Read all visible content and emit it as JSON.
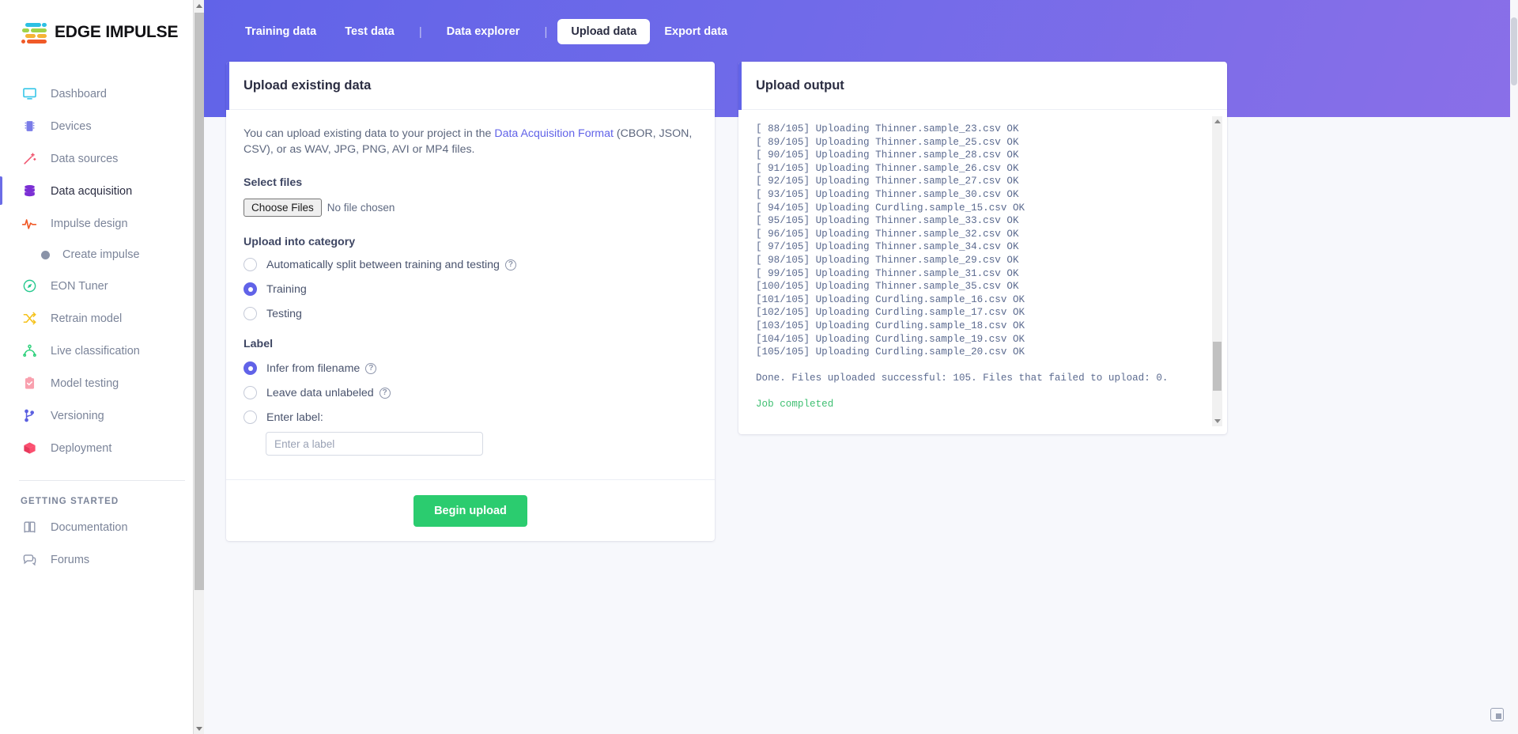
{
  "brand": {
    "name": "EDGE IMPULSE"
  },
  "sidebar": {
    "items": [
      {
        "label": "Dashboard",
        "icon": "monitor-icon"
      },
      {
        "label": "Devices",
        "icon": "chip-icon"
      },
      {
        "label": "Data sources",
        "icon": "wand-icon"
      },
      {
        "label": "Data acquisition",
        "icon": "database-icon"
      },
      {
        "label": "Impulse design",
        "icon": "pulse-icon"
      }
    ],
    "sub_item": {
      "label": "Create impulse",
      "icon": "dot-icon"
    },
    "items2": [
      {
        "label": "EON Tuner",
        "icon": "compass-icon"
      },
      {
        "label": "Retrain model",
        "icon": "shuffle-icon"
      },
      {
        "label": "Live classification",
        "icon": "network-icon"
      },
      {
        "label": "Model testing",
        "icon": "clipboard-check-icon"
      },
      {
        "label": "Versioning",
        "icon": "branch-icon"
      },
      {
        "label": "Deployment",
        "icon": "cube-icon"
      }
    ],
    "section_label": "GETTING STARTED",
    "items3": [
      {
        "label": "Documentation",
        "icon": "book-icon"
      },
      {
        "label": "Forums",
        "icon": "chat-icon"
      }
    ]
  },
  "tabs": [
    {
      "label": "Training data",
      "active": false
    },
    {
      "label": "Test data",
      "active": false
    },
    {
      "label": "Data explorer",
      "active": false
    },
    {
      "label": "Upload data",
      "active": true
    },
    {
      "label": "Export data",
      "active": false
    }
  ],
  "upload_card": {
    "title": "Upload existing data",
    "intro_1": "You can upload existing data to your project in the ",
    "intro_link": "Data Acquisition Format",
    "intro_2": " (CBOR, JSON, CSV), or as WAV, JPG, PNG, AVI or MP4 files.",
    "select_files_label": "Select files",
    "choose_files_button": "Choose Files",
    "no_file_chosen": "No file chosen",
    "category_label": "Upload into category",
    "category_options": [
      {
        "label": "Automatically split between training and testing",
        "checked": false,
        "help": true
      },
      {
        "label": "Training",
        "checked": true,
        "help": false
      },
      {
        "label": "Testing",
        "checked": false,
        "help": false
      }
    ],
    "label_group_label": "Label",
    "label_options": [
      {
        "label": "Infer from filename",
        "checked": true,
        "help": true
      },
      {
        "label": "Leave data unlabeled",
        "checked": false,
        "help": true
      },
      {
        "label": "Enter label:",
        "checked": false,
        "help": false
      }
    ],
    "label_input_value": "",
    "label_input_placeholder": "Enter a label",
    "begin_upload_button": "Begin upload"
  },
  "output_card": {
    "title": "Upload output",
    "lines": [
      "[ 88/105] Uploading Thinner.sample_23.csv OK",
      "[ 89/105] Uploading Thinner.sample_25.csv OK",
      "[ 90/105] Uploading Thinner.sample_28.csv OK",
      "[ 91/105] Uploading Thinner.sample_26.csv OK",
      "[ 92/105] Uploading Thinner.sample_27.csv OK",
      "[ 93/105] Uploading Thinner.sample_30.csv OK",
      "[ 94/105] Uploading Curdling.sample_15.csv OK",
      "[ 95/105] Uploading Thinner.sample_33.csv OK",
      "[ 96/105] Uploading Thinner.sample_32.csv OK",
      "[ 97/105] Uploading Thinner.sample_34.csv OK",
      "[ 98/105] Uploading Thinner.sample_29.csv OK",
      "[ 99/105] Uploading Thinner.sample_31.csv OK",
      "[100/105] Uploading Thinner.sample_35.csv OK",
      "[101/105] Uploading Curdling.sample_16.csv OK",
      "[102/105] Uploading Curdling.sample_17.csv OK",
      "[103/105] Uploading Curdling.sample_18.csv OK",
      "[104/105] Uploading Curdling.sample_19.csv OK",
      "[105/105] Uploading Curdling.sample_20.csv OK"
    ],
    "summary": "Done. Files uploaded successful: 105. Files that failed to upload: 0.",
    "status": "Job completed"
  },
  "colors": {
    "brand_purple": "#6163e8",
    "success_green": "#2bcc6f",
    "console_green": "#3fbf72",
    "console_text": "#5b6a8f"
  }
}
